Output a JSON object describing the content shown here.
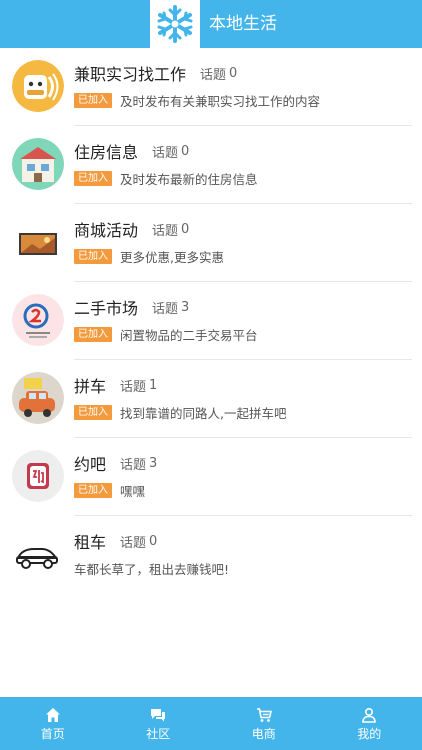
{
  "header": {
    "title": "本地生活",
    "logo_icon": "snowflake-icon"
  },
  "topic_label": "话题",
  "joined_label": "已加入",
  "colors": {
    "accent": "#43b5ea",
    "badge": "#f39a3d"
  },
  "items": [
    {
      "name": "兼职实习找工作",
      "topics": "0",
      "joined": true,
      "desc": "及时发布有关兼职实习找工作的内容",
      "icon": "part-time-job-icon"
    },
    {
      "name": "住房信息",
      "topics": "0",
      "joined": true,
      "desc": "及时发布最新的住房信息",
      "icon": "housing-icon"
    },
    {
      "name": "商城活动",
      "topics": "0",
      "joined": true,
      "desc": "更多优惠,更多实惠",
      "icon": "mall-activity-icon"
    },
    {
      "name": "二手市场",
      "topics": "3",
      "joined": true,
      "desc": "闲置物品的二手交易平台",
      "icon": "second-hand-icon"
    },
    {
      "name": "拼车",
      "topics": "1",
      "joined": true,
      "desc": "找到靠谱的同路人,一起拼车吧",
      "icon": "carpool-icon"
    },
    {
      "name": "约吧",
      "topics": "3",
      "joined": true,
      "desc": "嘿嘿",
      "icon": "dating-icon"
    },
    {
      "name": "租车",
      "topics": "0",
      "joined": false,
      "desc": "车都长草了，租出去赚钱吧!",
      "icon": "car-rental-icon"
    }
  ],
  "tabbar": [
    {
      "label": "首页",
      "icon": "home-icon"
    },
    {
      "label": "社区",
      "icon": "chat-icon"
    },
    {
      "label": "电商",
      "icon": "cart-icon"
    },
    {
      "label": "我的",
      "icon": "user-icon"
    }
  ]
}
